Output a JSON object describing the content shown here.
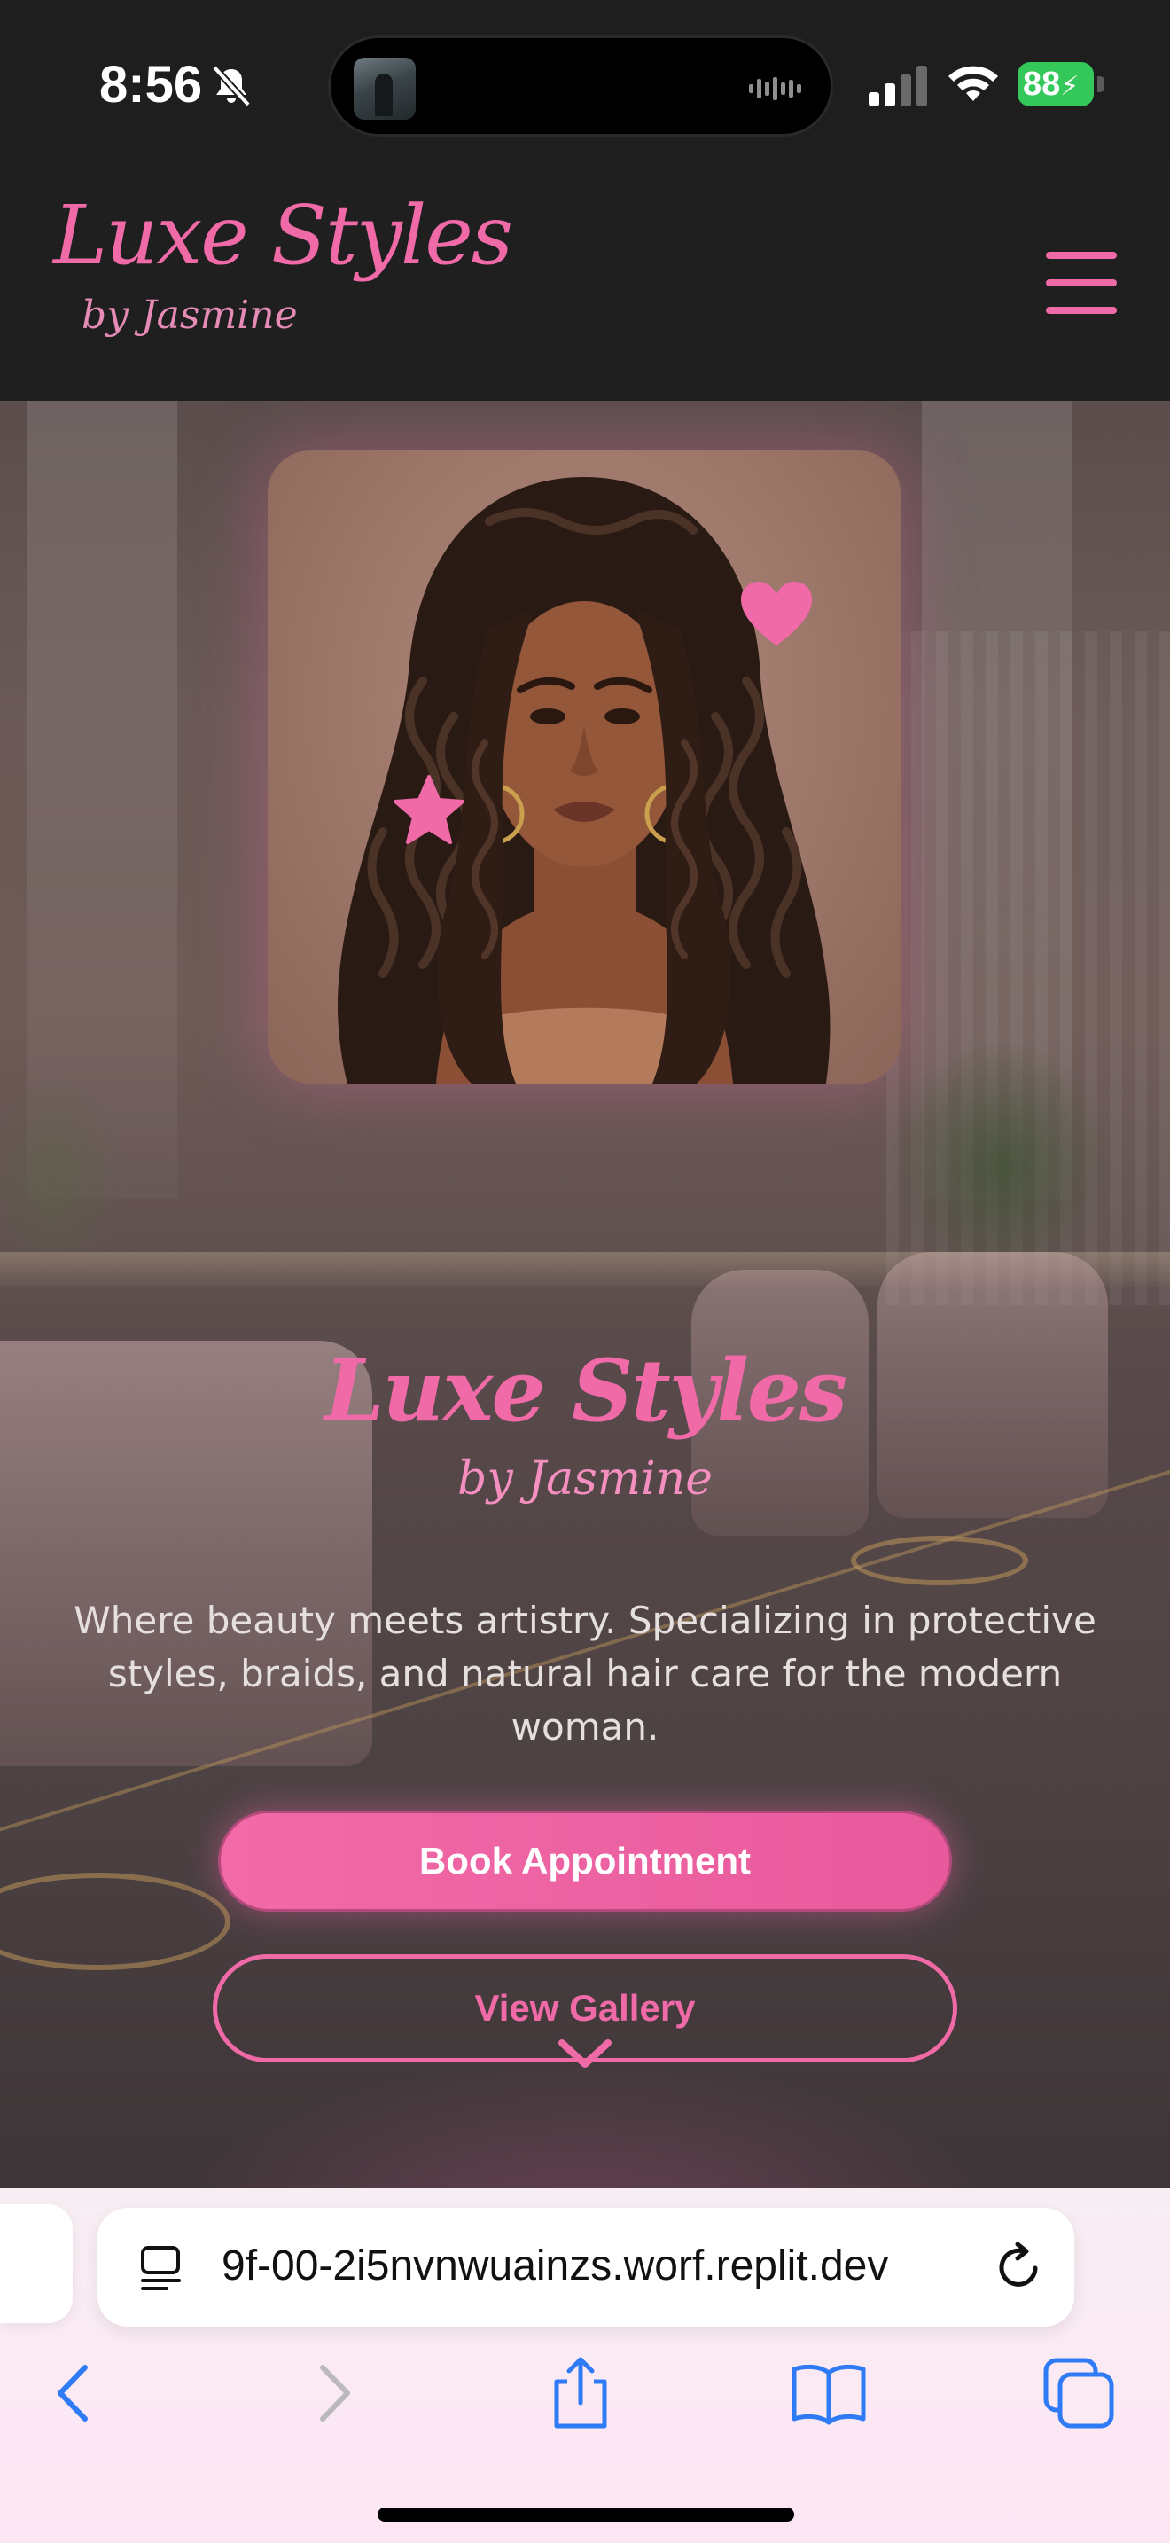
{
  "status_bar": {
    "time": "8:56",
    "battery": "88"
  },
  "header": {
    "logo_title": "Luxe Styles",
    "logo_subtitle": "by Jasmine"
  },
  "hero": {
    "title": "Luxe Styles",
    "subtitle": "by Jasmine",
    "description": "Where beauty meets artistry. Specializing in protective styles, braids, and natural hair care for the modern woman.",
    "primary_button": "Book Appointment",
    "secondary_button": "View Gallery"
  },
  "browser": {
    "url": "9f-00-2i5nvnwuainzs.worf.replit.dev"
  },
  "colors": {
    "accent": "#f06aa8",
    "header_bg": "#1f1f1f",
    "battery": "#34c759",
    "browser_blue": "#2f7bf5"
  }
}
